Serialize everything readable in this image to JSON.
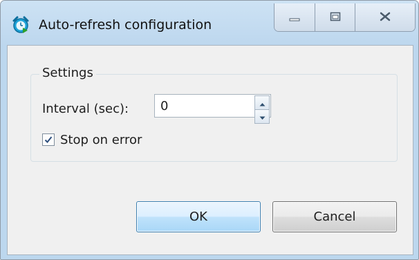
{
  "window": {
    "title": "Auto-refresh configuration",
    "icon": "alarm-clock-icon",
    "controls": [
      "minimize-icon",
      "maximize-icon",
      "close-icon"
    ]
  },
  "settings": {
    "group_title": "Settings",
    "interval_label": "Interval (sec):",
    "interval_value": "0",
    "stop_on_error_label": "Stop on error",
    "stop_on_error_checked": true
  },
  "buttons": {
    "ok": "OK",
    "cancel": "Cancel"
  },
  "colors": {
    "title_bar": "#bcd7ee",
    "ok_button_accent": "#a9d7f7",
    "dialog_background": "#f0f0f0"
  }
}
